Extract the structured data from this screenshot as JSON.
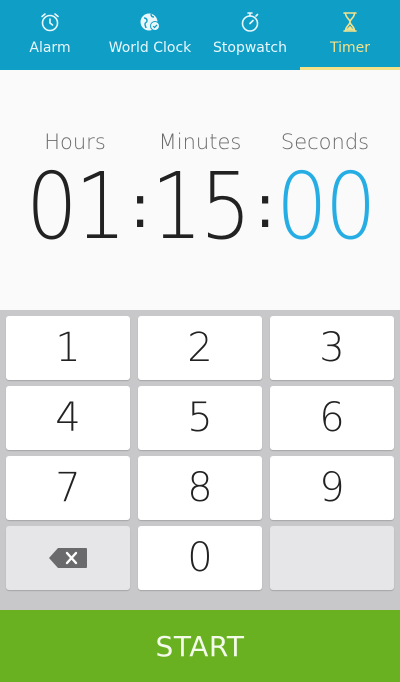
{
  "tabs": [
    {
      "label": "Alarm",
      "icon": "alarm-clock-icon"
    },
    {
      "label": "World Clock",
      "icon": "globe-clock-icon"
    },
    {
      "label": "Stopwatch",
      "icon": "stopwatch-icon"
    },
    {
      "label": "Timer",
      "icon": "hourglass-icon",
      "active": true
    }
  ],
  "timer": {
    "hours_label": "Hours",
    "minutes_label": "Minutes",
    "seconds_label": "Seconds",
    "hours": "01",
    "minutes": "15",
    "seconds": "00",
    "separator": ":",
    "active_field": "seconds"
  },
  "keypad": {
    "keys": [
      "1",
      "2",
      "3",
      "4",
      "5",
      "6",
      "7",
      "8",
      "9",
      "0"
    ],
    "backspace_icon": "backspace-icon"
  },
  "start_label": "START",
  "colors": {
    "tab_bar": "#0f9ec6",
    "tab_active": "#f4e28a",
    "active_digits": "#26aee4",
    "start_button": "#6ab122",
    "keypad_background": "#c8c8cb"
  }
}
